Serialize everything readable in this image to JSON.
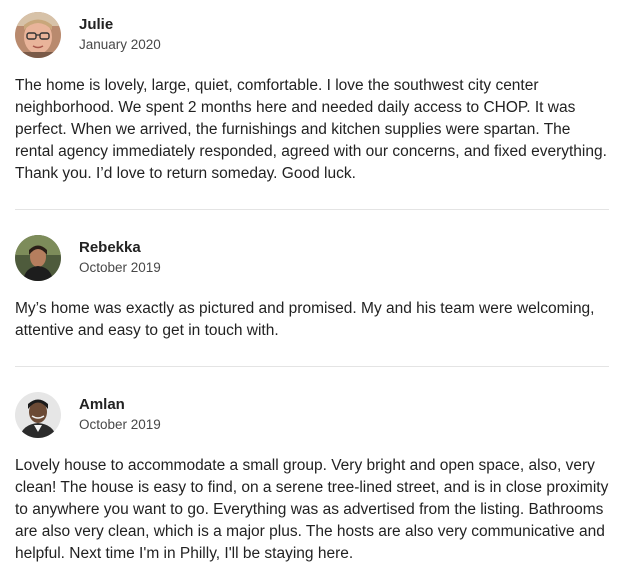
{
  "reviews": [
    {
      "name": "Julie",
      "date": "January 2020",
      "avatar_icon": "avatar-photo-julie",
      "text": "The home is lovely, large, quiet, comfortable. I love the southwest city center neighborhood. We spent 2 months here and needed daily access to CHOP. It was perfect. When we arrived, the furnishings and kitchen supplies were spartan. The rental agency immediately responded, agreed with our concerns, and fixed everything. Thank you. I’d love to return someday. Good luck."
    },
    {
      "name": "Rebekka",
      "date": "October 2019",
      "avatar_icon": "avatar-photo-rebekka",
      "text": "My’s home was exactly as pictured and promised. My and his team were welcoming, attentive and easy to get in touch with."
    },
    {
      "name": "Amlan",
      "date": "October 2019",
      "avatar_icon": "avatar-photo-amlan",
      "text": "Lovely house to accommodate a small group. Very bright and open space, also, very clean! The house is easy to find, on a serene tree-lined street, and is in close proximity to anywhere you want to go. Everything was as advertised from the listing. Bathrooms are also very clean, which is a major plus. The hosts are also very communicative and helpful. Next time I'm in Philly, I'll be staying here."
    }
  ],
  "colors": {
    "text": "#222222",
    "date": "#484848",
    "divider": "#e4e4e4"
  }
}
